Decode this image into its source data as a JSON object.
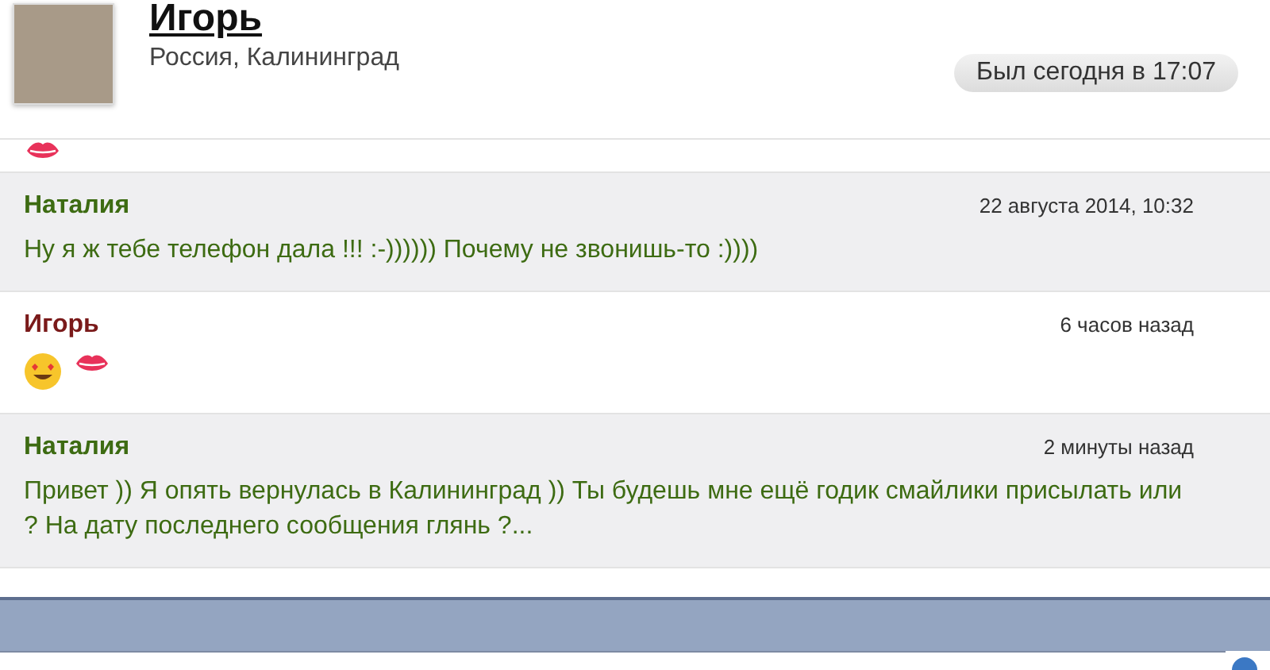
{
  "profile": {
    "name": "Игорь",
    "location": "Россия, Калининград",
    "status": "Был сегодня в 17:07"
  },
  "messages": [
    {
      "kind": "kiss",
      "shaded": false
    },
    {
      "kind": "text",
      "shaded": true,
      "author": "Наталия",
      "color": "#3d6b12",
      "time": "22 августа 2014, 10:32",
      "text": "Ну я ж тебе телефон дала !!! :-)))))) Почему не звонишь-то :))))"
    },
    {
      "kind": "smile-kiss",
      "shaded": false,
      "author": "Игорь",
      "color": "#7a1a1a",
      "time": "6 часов назад"
    },
    {
      "kind": "text",
      "shaded": true,
      "author": "Наталия",
      "color": "#3d6b12",
      "time": "2 минуты назад",
      "text": "Привет )) Я опять вернулась в Калининград )) Ты будешь мне ещё годик смайлики присылать или ? На дату последнего сообщения глянь ?..."
    }
  ]
}
